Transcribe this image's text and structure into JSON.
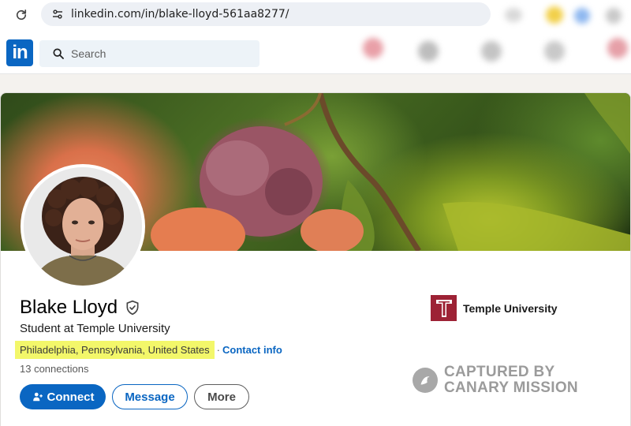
{
  "browser": {
    "url": "linkedin.com/in/blake-lloyd-561aa8277/",
    "reload_icon": "reload-icon",
    "site_settings_icon": "tune-icon"
  },
  "nav": {
    "logo_text": "in",
    "search_placeholder": "Search"
  },
  "profile": {
    "name": "Blake Lloyd",
    "headline": "Student at Temple University",
    "location": "Philadelphia, Pennsylvania, United States",
    "separator": "·",
    "contact_info": "Contact info",
    "connections": "13 connections",
    "education": "Temple University",
    "education_logo_letter": "T"
  },
  "actions": {
    "connect": "Connect",
    "message": "Message",
    "more": "More"
  },
  "watermark": {
    "line1": "CAPTURED BY",
    "line2": "CANARY MISSION"
  },
  "colors": {
    "linkedin_blue": "#0a66c2",
    "highlight": "#f3f76a",
    "temple_red": "#9d2235"
  }
}
